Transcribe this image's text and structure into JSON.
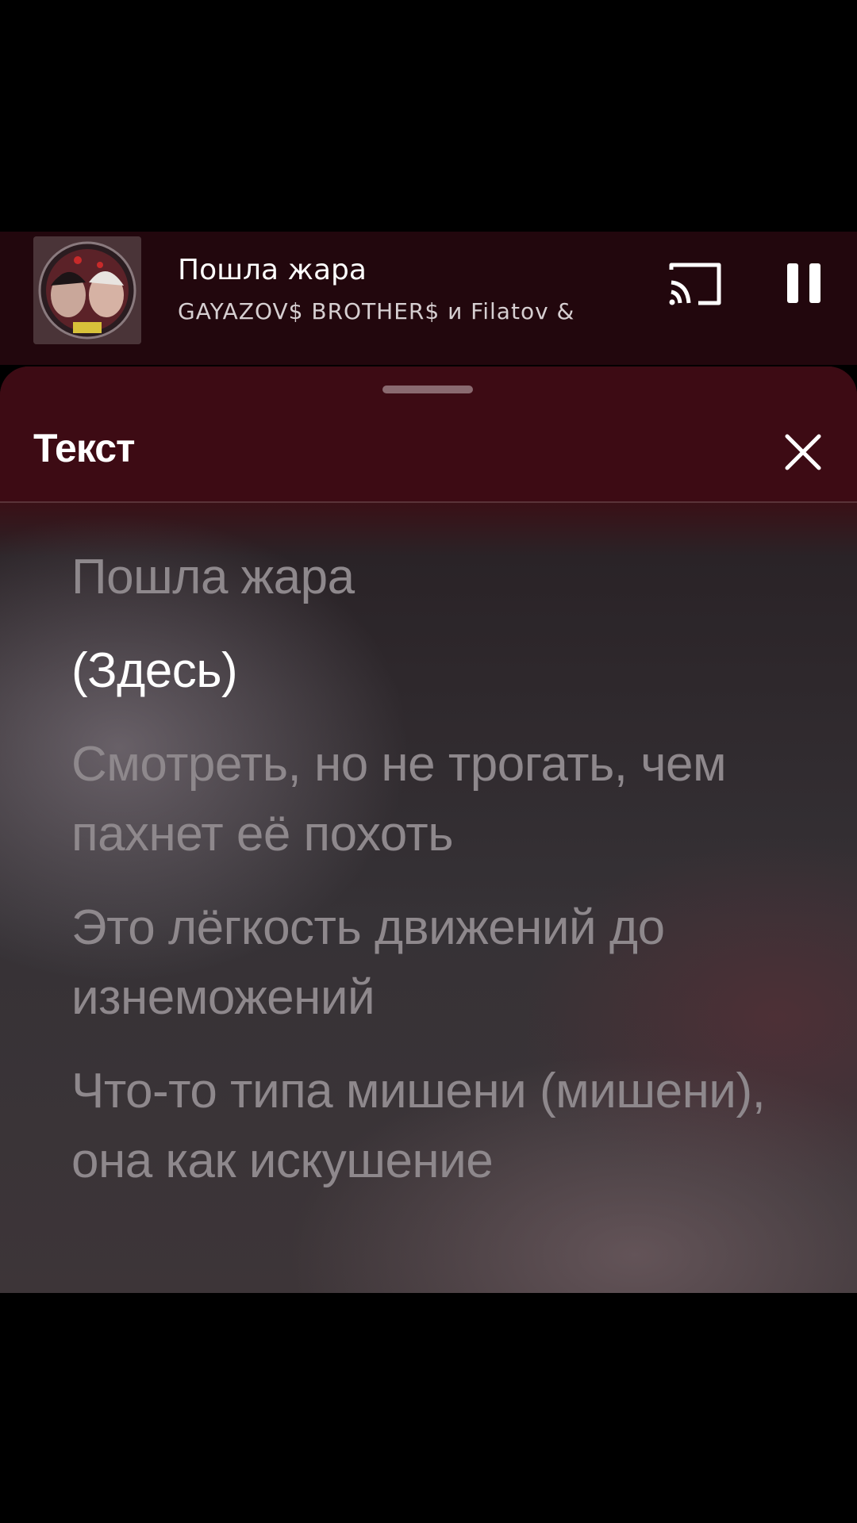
{
  "now_playing": {
    "title": "Пошла жара",
    "artist": "GAYAZOV$ BROTHER$ и Filatov &",
    "cast_icon": "cast-icon",
    "pause_icon": "pause-icon"
  },
  "lyrics_sheet": {
    "title": "Текст",
    "close_icon": "close-icon",
    "lines": [
      {
        "text": "Пошла жара",
        "active": false
      },
      {
        "text": "(Здесь)",
        "active": true
      },
      {
        "text": "Смотреть, но не трогать, чем пахнет её похоть",
        "active": false
      },
      {
        "text": "Это лёгкость движений до изнеможений",
        "active": false
      },
      {
        "text": "Что-то типа мишени (мишени), она как искушение",
        "active": false
      }
    ]
  },
  "colors": {
    "player_bg": "#22070d",
    "sheet_header_bg": "#3d0b14",
    "active_lyric": "#ffffff",
    "inactive_lyric": "#8e888c"
  }
}
